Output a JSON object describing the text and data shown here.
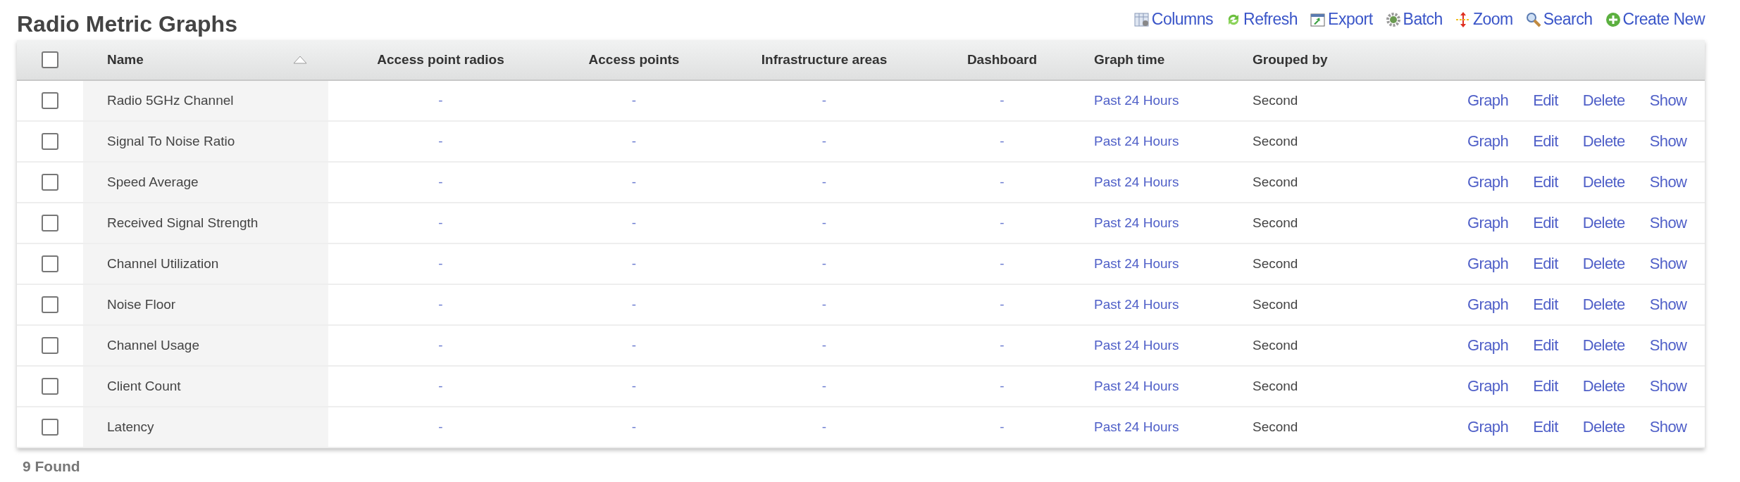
{
  "title": "Radio Metric Graphs",
  "toolbar": [
    {
      "kind": "columns",
      "label": "Columns"
    },
    {
      "kind": "refresh",
      "label": "Refresh"
    },
    {
      "kind": "export",
      "label": "Export"
    },
    {
      "kind": "batch",
      "label": "Batch"
    },
    {
      "kind": "zoom",
      "label": "Zoom"
    },
    {
      "kind": "search",
      "label": "Search"
    },
    {
      "kind": "create",
      "label": "Create New"
    }
  ],
  "table": {
    "select_all": {
      "checked": false
    },
    "columns": [
      {
        "label": "Name",
        "sorted": true
      },
      {
        "label": "Access point radios",
        "sorted": false
      },
      {
        "label": "Access points",
        "sorted": false
      },
      {
        "label": "Infrastructure areas",
        "sorted": false
      },
      {
        "label": "Dashboard",
        "sorted": false
      },
      {
        "label": "Graph time",
        "sorted": false
      },
      {
        "label": "Grouped by",
        "sorted": false
      }
    ],
    "rows": [
      {
        "checked": false,
        "name": "Radio 5GHz Channel",
        "access_point_radios": "-",
        "access_points": "-",
        "infrastructure_areas": "-",
        "dashboard": "-",
        "graph_time": "Past 24 Hours",
        "grouped_by": "Second",
        "actions": [
          "Graph",
          "Edit",
          "Delete",
          "Show"
        ]
      },
      {
        "checked": false,
        "name": "Signal To Noise Ratio",
        "access_point_radios": "-",
        "access_points": "-",
        "infrastructure_areas": "-",
        "dashboard": "-",
        "graph_time": "Past 24 Hours",
        "grouped_by": "Second",
        "actions": [
          "Graph",
          "Edit",
          "Delete",
          "Show"
        ]
      },
      {
        "checked": false,
        "name": "Speed Average",
        "access_point_radios": "-",
        "access_points": "-",
        "infrastructure_areas": "-",
        "dashboard": "-",
        "graph_time": "Past 24 Hours",
        "grouped_by": "Second",
        "actions": [
          "Graph",
          "Edit",
          "Delete",
          "Show"
        ]
      },
      {
        "checked": false,
        "name": "Received Signal Strength",
        "access_point_radios": "-",
        "access_points": "-",
        "infrastructure_areas": "-",
        "dashboard": "-",
        "graph_time": "Past 24 Hours",
        "grouped_by": "Second",
        "actions": [
          "Graph",
          "Edit",
          "Delete",
          "Show"
        ]
      },
      {
        "checked": false,
        "name": "Channel Utilization",
        "access_point_radios": "-",
        "access_points": "-",
        "infrastructure_areas": "-",
        "dashboard": "-",
        "graph_time": "Past 24 Hours",
        "grouped_by": "Second",
        "actions": [
          "Graph",
          "Edit",
          "Delete",
          "Show"
        ]
      },
      {
        "checked": false,
        "name": "Noise Floor",
        "access_point_radios": "-",
        "access_points": "-",
        "infrastructure_areas": "-",
        "dashboard": "-",
        "graph_time": "Past 24 Hours",
        "grouped_by": "Second",
        "actions": [
          "Graph",
          "Edit",
          "Delete",
          "Show"
        ]
      },
      {
        "checked": false,
        "name": "Channel Usage",
        "access_point_radios": "-",
        "access_points": "-",
        "infrastructure_areas": "-",
        "dashboard": "-",
        "graph_time": "Past 24 Hours",
        "grouped_by": "Second",
        "actions": [
          "Graph",
          "Edit",
          "Delete",
          "Show"
        ]
      },
      {
        "checked": false,
        "name": "Client Count",
        "access_point_radios": "-",
        "access_points": "-",
        "infrastructure_areas": "-",
        "dashboard": "-",
        "graph_time": "Past 24 Hours",
        "grouped_by": "Second",
        "actions": [
          "Graph",
          "Edit",
          "Delete",
          "Show"
        ]
      },
      {
        "checked": false,
        "name": "Latency",
        "access_point_radios": "-",
        "access_points": "-",
        "infrastructure_areas": "-",
        "dashboard": "-",
        "graph_time": "Past 24 Hours",
        "grouped_by": "Second",
        "actions": [
          "Graph",
          "Edit",
          "Delete",
          "Show"
        ]
      }
    ]
  },
  "footer": "9 Found"
}
